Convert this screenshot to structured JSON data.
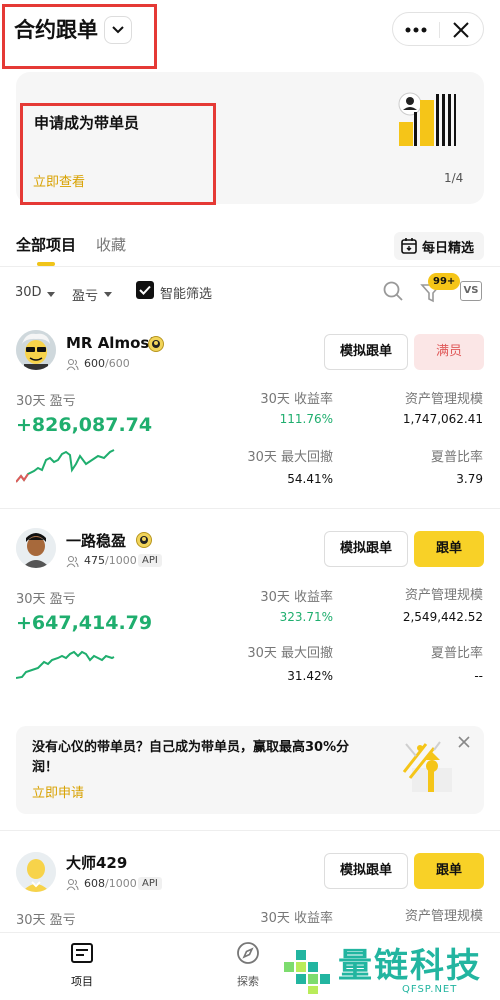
{
  "header": {
    "title": "合约跟单",
    "chevron_icon": "chevron-down-icon",
    "more_icon": "more-dots-icon",
    "close_icon": "close-icon"
  },
  "banner": {
    "title": "申请成为带单员",
    "link": "立即查看",
    "page_indicator": "1/4"
  },
  "tabs": {
    "all": "全部项目",
    "favorites": "收藏",
    "daily_pick": "每日精选"
  },
  "filters": {
    "period": "30D",
    "sort": "盈亏",
    "smart_filter": "智能筛选",
    "badge": "99+",
    "vs": "VS"
  },
  "traders": [
    {
      "name": "MR Almost",
      "followers": "600",
      "capacity": "/600",
      "api": "",
      "sim_button": "模拟跟单",
      "action_button": "满员",
      "pnl_label": "30天 盈亏",
      "pnl": "+826,087.74",
      "roi_label": "30天  收益率",
      "roi": "111.76%",
      "aum_label": "资产管理规模",
      "aum": "1,747,062.41",
      "mdd_label": "30天  最大回撤",
      "mdd": "54.41%",
      "sharpe_label": "夏普比率",
      "sharpe": "3.79"
    },
    {
      "name": "一路稳盈",
      "followers": "475",
      "capacity": "/1000",
      "api": "API",
      "sim_button": "模拟跟单",
      "action_button": "跟单",
      "pnl_label": "30天 盈亏",
      "pnl": "+647,414.79",
      "roi_label": "30天  收益率",
      "roi": "323.71%",
      "aum_label": "资产管理规模",
      "aum": "2,549,442.52",
      "mdd_label": "30天  最大回撤",
      "mdd": "31.42%",
      "sharpe_label": "夏普比率",
      "sharpe": "--"
    },
    {
      "name": "大师429",
      "followers": "608",
      "capacity": "/1000",
      "api": "API",
      "sim_button": "模拟跟单",
      "action_button": "跟单",
      "pnl_label": "30天 盈亏",
      "roi_label": "30天  收益率",
      "aum_label": "资产管理规模"
    }
  ],
  "invite": {
    "text": "没有心仪的带单员？自己成为带单员，赢取最高30%分润！",
    "link": "立即申请"
  },
  "bottom_nav": {
    "items": [
      "项目",
      "探索"
    ]
  },
  "watermark": {
    "text": "量链科技",
    "sub": "QFSP.NET"
  },
  "colors": {
    "accent": "#f8d127",
    "profit": "#1fae6e",
    "loss": "#e05a5a",
    "link": "#d8a100"
  }
}
